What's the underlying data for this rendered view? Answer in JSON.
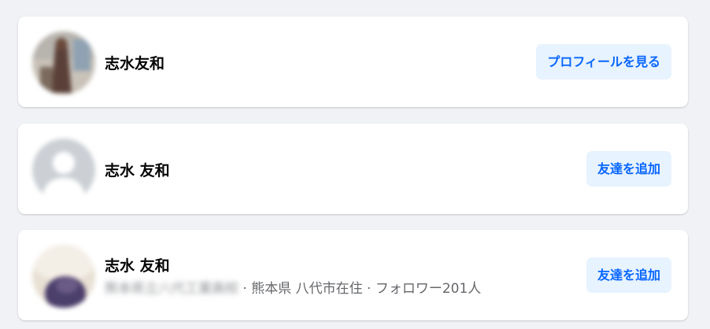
{
  "results": [
    {
      "name": "志水友和",
      "button_label": "プロフィールを見る",
      "avatar_icon": "profile-photo"
    },
    {
      "name": "志水 友和",
      "button_label": "友達を追加",
      "avatar_icon": "default-avatar-icon"
    },
    {
      "name": "志水 友和",
      "button_label": "友達を追加",
      "avatar_icon": "profile-photo",
      "details_redacted": "熊本県立八代工業高校",
      "details": " · 熊本県 八代市在住 · フォロワー201人"
    }
  ],
  "colors": {
    "page_background": "#f0f2f5",
    "card_background": "#ffffff",
    "button_background": "#e7f3ff",
    "button_text": "#0866ff",
    "name_text": "#050505",
    "secondary_text": "#65676b"
  }
}
